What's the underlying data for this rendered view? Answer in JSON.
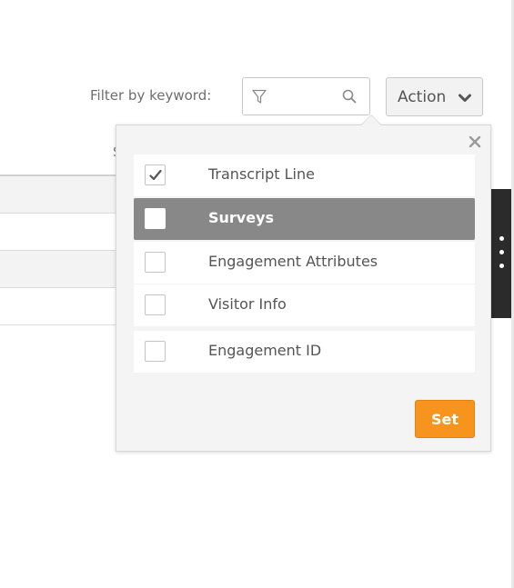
{
  "toolbar": {
    "filter_label": "Filter by keyword:",
    "search_value": "",
    "search_placeholder": "",
    "action_label": "Action"
  },
  "background": {
    "peek_text": "S"
  },
  "column_picker": {
    "items": [
      {
        "label": "Transcript Line",
        "checked": true,
        "highlighted": false
      },
      {
        "label": "Surveys",
        "checked": false,
        "highlighted": true
      },
      {
        "label": "Engagement Attributes",
        "checked": false,
        "highlighted": false
      },
      {
        "label": "Visitor Info",
        "checked": false,
        "highlighted": false
      },
      {
        "label": "Engagement ID",
        "checked": false,
        "highlighted": false
      }
    ],
    "set_label": "Set"
  },
  "colors": {
    "accent": "#f7941d",
    "highlight": "#888888",
    "side_handle": "#2b2b2b"
  },
  "icons": [
    "funnel-icon",
    "search-icon",
    "chevron-down-icon",
    "close-icon",
    "checkmark-icon",
    "kebab-menu-icon"
  ]
}
